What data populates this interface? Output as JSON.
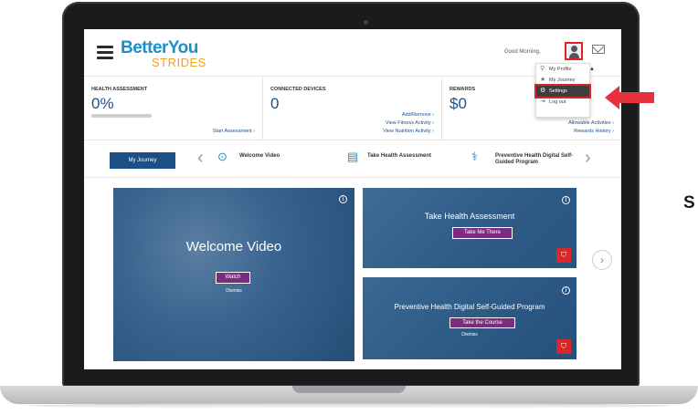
{
  "header": {
    "logo_line1": "BetterYou",
    "logo_line2": "STRIDES",
    "greeting": "Good Morning,"
  },
  "dropdown": {
    "items": [
      {
        "icon": "person-icon",
        "label": "My Profile"
      },
      {
        "icon": "star-icon",
        "label": "My Journey"
      },
      {
        "icon": "gear-icon",
        "label": "Settings"
      },
      {
        "icon": "logout-icon",
        "label": "Log out"
      }
    ],
    "active": "Settings"
  },
  "stats": {
    "health": {
      "title": "HEALTH ASSESSMENT",
      "value": "0%",
      "progress": 0,
      "link": "Start Assessment"
    },
    "devices": {
      "title": "CONNECTED DEVICES",
      "value": "0",
      "links": [
        "Add/Remove",
        "View Fitness Activity",
        "View Nutrition Activity"
      ]
    },
    "rewards": {
      "title": "REWARDS",
      "value": "$0",
      "links": [
        "Allowable Activities",
        "Rewards History"
      ]
    }
  },
  "journey": {
    "tab": "My Journey",
    "items": [
      "Welcome Video",
      "Take Health Assessment",
      "Preventive Health Digital Self-Guided Program"
    ]
  },
  "cards": {
    "welcome": {
      "title": "Welcome Video",
      "button": "Watch",
      "dismiss": "Dismiss"
    },
    "health": {
      "title": "Take Health Assessment",
      "button": "Take Me There"
    },
    "program": {
      "title": "Preventive Health Digital Self-Guided Program",
      "button": "Take the Course",
      "dismiss": "Dismiss"
    }
  },
  "side_letter": "S",
  "colors": {
    "brand_blue": "#1a8fc8",
    "brand_orange": "#f0a21e",
    "navy": "#1b4f86",
    "purple": "#7a2d7e",
    "highlight_red": "#d9262b"
  }
}
